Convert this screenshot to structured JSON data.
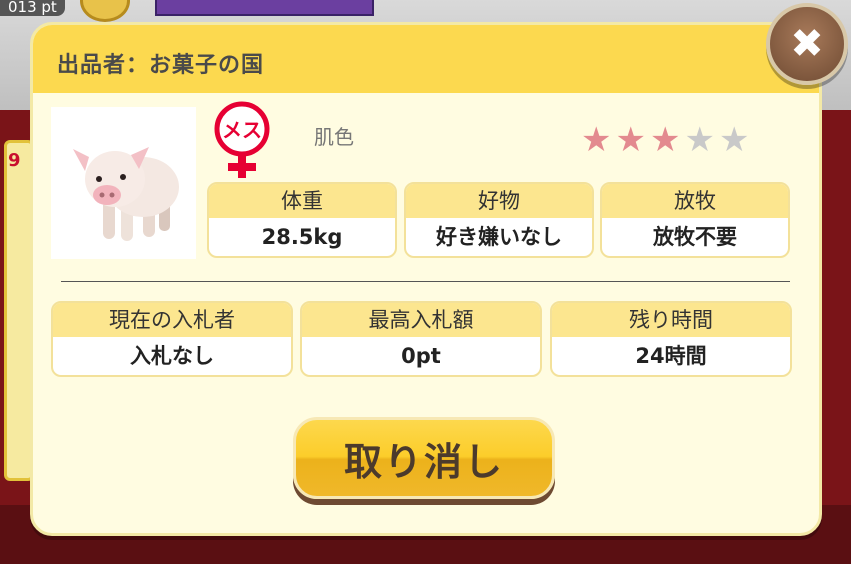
{
  "background": {
    "points_text": "013 pt",
    "left_badge_char": "9"
  },
  "dialog": {
    "seller_label": "出品者：お菓子の国",
    "close_icon": "close-x-icon",
    "gender_icon": "female-symbol-icon",
    "gender_label": "メス",
    "color_label": "肌色",
    "rating": {
      "filled": 3,
      "total": 5,
      "filled_color": "#e38a8f",
      "empty_color": "#c9c9c9"
    },
    "stats": [
      {
        "label": "体重",
        "value": "28.5kg"
      },
      {
        "label": "好物",
        "value": "好き嫌いなし"
      },
      {
        "label": "放牧",
        "value": "放牧不要"
      }
    ],
    "auction": [
      {
        "label": "現在の入札者",
        "value": "入札なし"
      },
      {
        "label": "最高入札額",
        "value": "0pt"
      },
      {
        "label": "残り時間",
        "value": "24時間"
      }
    ],
    "cancel_label": "取り消し"
  },
  "colors": {
    "header": "#fcd94f",
    "panel": "#fffce1",
    "gender_red": "#e60033"
  }
}
